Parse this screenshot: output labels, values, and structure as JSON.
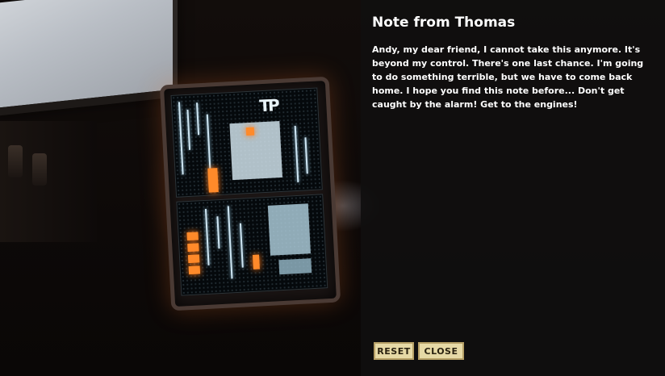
{
  "note": {
    "title": "Note from Thomas",
    "body": "Andy, my dear friend, I cannot take this anymore. It's beyond my control. There's one last chance. I'm going to do something terrible, but we have to come back home. I hope you find this note before... Don't get caught by the alarm! Get to the engines!"
  },
  "buttons": {
    "reset_label": "RESET",
    "close_label": "CLOSE"
  },
  "scene": {
    "panel_logo": "TP",
    "accent_amber": "#ff8a2a",
    "screen_glow": "#cfe6f3",
    "button_bg": "#e6d9a6"
  }
}
